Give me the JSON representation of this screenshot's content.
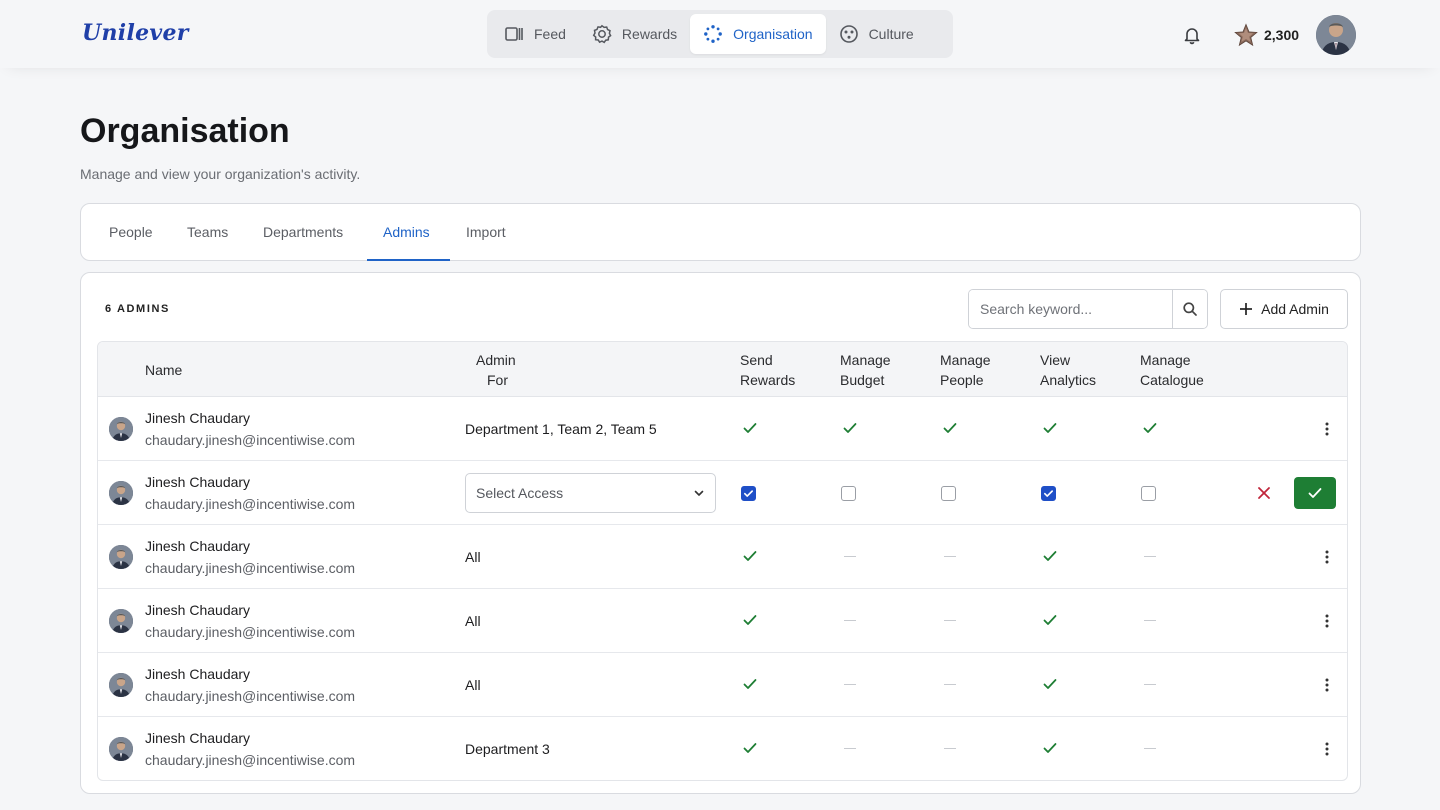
{
  "app": {
    "logo_text": "Unilever",
    "points": "2,300"
  },
  "nav": {
    "items": [
      {
        "label": "Feed",
        "icon": "feed-icon"
      },
      {
        "label": "Rewards",
        "icon": "rewards-icon"
      },
      {
        "label": "Organisation",
        "icon": "organisation-icon",
        "active": true
      },
      {
        "label": "Culture",
        "icon": "culture-icon"
      }
    ]
  },
  "page": {
    "title": "Organisation",
    "subtitle": "Manage and view your organization's activity."
  },
  "tabs": {
    "items": [
      "People",
      "Teams",
      "Departments",
      "Admins",
      "Import"
    ],
    "active": "Admins"
  },
  "admins": {
    "count_label": "6 ADMINS",
    "search_placeholder": "Search keyword...",
    "add_label": "Add Admin",
    "columns": {
      "name": "Name",
      "admin_for_1": "Admin",
      "admin_for_2": "For",
      "send_rewards_1": "Send",
      "send_rewards_2": "Rewards",
      "manage_budget_1": "Manage",
      "manage_budget_2": "Budget",
      "manage_people_1": "Manage",
      "manage_people_2": "People",
      "view_analytics_1": "View",
      "view_analytics_2": "Analytics",
      "manage_catalogue_1": "Manage",
      "manage_catalogue_2": "Catalogue"
    },
    "select_placeholder": "Select Access",
    "rows": [
      {
        "name": "Jinesh Chaudary",
        "email": "chaudary.jinesh@incentiwise.com",
        "admin_for": "Department 1, Team 2, Team 5",
        "perms": [
          true,
          true,
          true,
          true,
          true
        ]
      },
      {
        "name": "Jinesh Chaudary",
        "email": "chaudary.jinesh@incentiwise.com",
        "admin_for": "",
        "editing": true,
        "perms": [
          true,
          false,
          false,
          true,
          false
        ]
      },
      {
        "name": "Jinesh Chaudary",
        "email": "chaudary.jinesh@incentiwise.com",
        "admin_for": "All",
        "perms": [
          true,
          false,
          false,
          true,
          false
        ]
      },
      {
        "name": "Jinesh Chaudary",
        "email": "chaudary.jinesh@incentiwise.com",
        "admin_for": "All",
        "perms": [
          true,
          false,
          false,
          true,
          false
        ]
      },
      {
        "name": "Jinesh Chaudary",
        "email": "chaudary.jinesh@incentiwise.com",
        "admin_for": "All",
        "perms": [
          true,
          false,
          false,
          true,
          false
        ]
      },
      {
        "name": "Jinesh Chaudary",
        "email": "chaudary.jinesh@incentiwise.com",
        "admin_for": "Department 3",
        "perms": [
          true,
          false,
          false,
          true,
          false
        ]
      }
    ]
  },
  "colors": {
    "accent": "#1f63c7",
    "check_green": "#1e7e34",
    "danger": "#c0263b"
  }
}
